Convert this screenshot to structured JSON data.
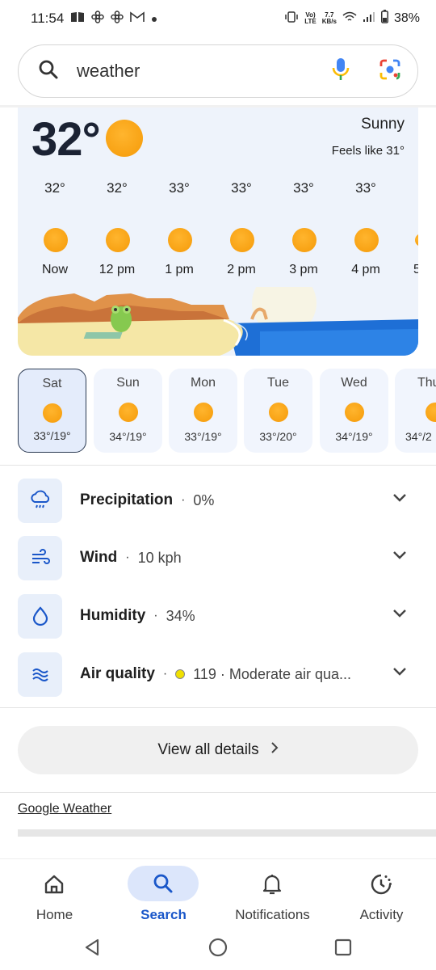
{
  "status_bar": {
    "time": "11:54",
    "network_speed_top": "7.7",
    "network_speed_bottom": "KB/s",
    "volte": "Vo)",
    "lte": "LTE",
    "battery": "38%",
    "left_icons": [
      "book-icon",
      "fan-icon",
      "fan-icon",
      "gmail-icon",
      "dot-icon"
    ],
    "right_icons": [
      "vibrate-icon",
      "wifi-icon",
      "signal-icon",
      "battery-icon"
    ]
  },
  "search": {
    "query": "weather",
    "icons": [
      "search-icon",
      "mic-icon",
      "lens-icon"
    ]
  },
  "current": {
    "temperature": "32°",
    "condition": "Sunny",
    "feels_like": "Feels like 31°",
    "icon": "sun-icon"
  },
  "hourly": [
    {
      "temp": "32°",
      "time": "Now"
    },
    {
      "temp": "32°",
      "time": "12 pm"
    },
    {
      "temp": "33°",
      "time": "1 pm"
    },
    {
      "temp": "33°",
      "time": "2 pm"
    },
    {
      "temp": "33°",
      "time": "3 pm"
    },
    {
      "temp": "33°",
      "time": "4 pm"
    },
    {
      "temp": "",
      "time": "5"
    }
  ],
  "daily": [
    {
      "day": "Sat",
      "temps": "33°/19°",
      "selected": true
    },
    {
      "day": "Sun",
      "temps": "34°/19°",
      "selected": false
    },
    {
      "day": "Mon",
      "temps": "33°/19°",
      "selected": false
    },
    {
      "day": "Tue",
      "temps": "33°/20°",
      "selected": false
    },
    {
      "day": "Wed",
      "temps": "34°/19°",
      "selected": false
    },
    {
      "day": "Thu",
      "temps": "34°/2",
      "selected": false
    }
  ],
  "details": [
    {
      "label": "Precipitation",
      "value": "0%",
      "icon": "rain-cloud-icon"
    },
    {
      "label": "Wind",
      "value": "10 kph",
      "icon": "wind-icon"
    },
    {
      "label": "Humidity",
      "value": "34%",
      "icon": "droplet-icon"
    },
    {
      "label": "Air quality",
      "value": "119 · Moderate air qua...",
      "icon": "air-quality-icon"
    }
  ],
  "view_all": "View all details",
  "source": "Google Weather",
  "bottom_nav": [
    {
      "label": "Home",
      "icon": "home-icon",
      "active": false
    },
    {
      "label": "Search",
      "icon": "search-icon",
      "active": true
    },
    {
      "label": "Notifications",
      "icon": "bell-icon",
      "active": false
    },
    {
      "label": "Activity",
      "icon": "activity-icon",
      "active": false
    }
  ],
  "system_nav": [
    "back-icon",
    "home-circle-icon",
    "recents-icon"
  ],
  "colors": {
    "accent": "#1a57c9",
    "sun": "#f59a08",
    "card_bg": "#eef3fb",
    "aq_dot": "#f0e000"
  }
}
